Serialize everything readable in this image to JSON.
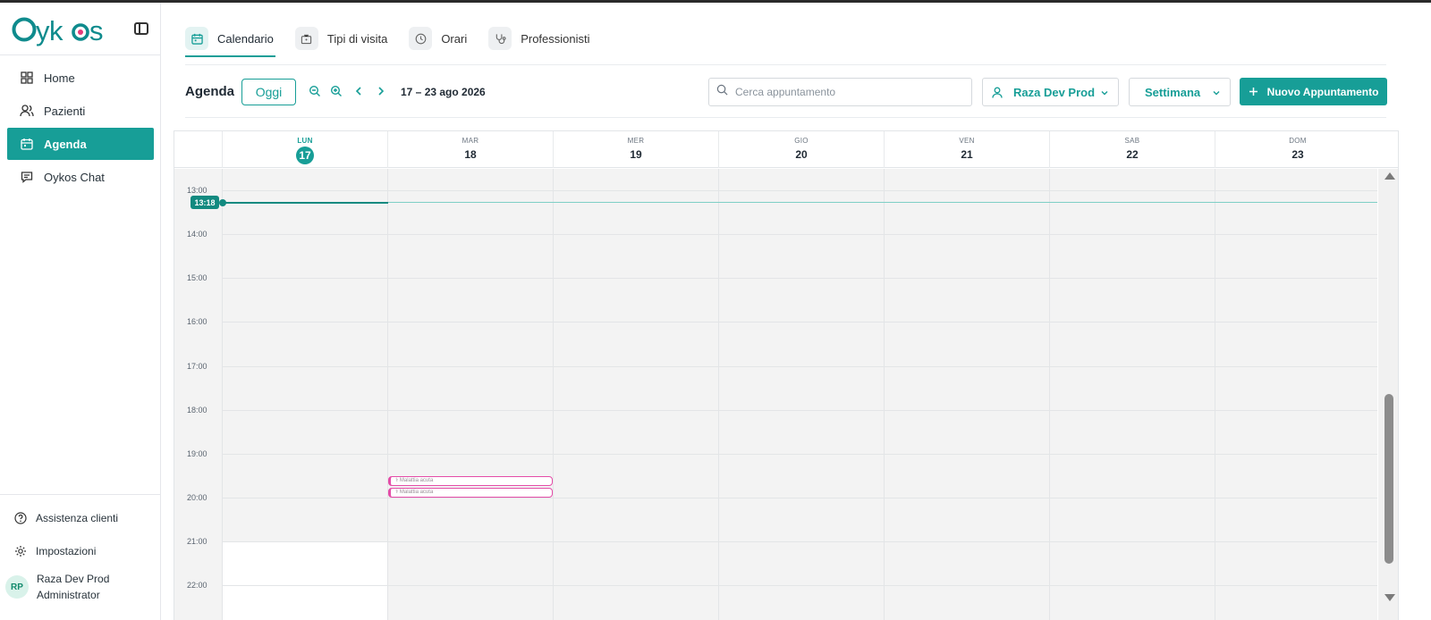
{
  "app": {
    "logo_text": "Oykos",
    "accent_color": "#179e97",
    "event_color": "#e44ca8"
  },
  "sidebar": {
    "items": [
      {
        "label": "Home",
        "icon": "grid-icon",
        "active": false
      },
      {
        "label": "Pazienti",
        "icon": "users-icon",
        "active": false
      },
      {
        "label": "Agenda",
        "icon": "calendar-icon",
        "active": true
      },
      {
        "label": "Oykos Chat",
        "icon": "chat-icon",
        "active": false
      }
    ],
    "support_label": "Assistenza clienti",
    "settings_label": "Impostazioni",
    "user": {
      "initials": "RP",
      "name": "Raza Dev Prod",
      "role": "Administrator"
    }
  },
  "tabs": [
    {
      "label": "Calendario",
      "icon": "calendar-icon",
      "active": true
    },
    {
      "label": "Tipi di visita",
      "icon": "briefcase-icon",
      "active": false
    },
    {
      "label": "Orari",
      "icon": "clock-icon",
      "active": false
    },
    {
      "label": "Professionisti",
      "icon": "stethoscope-icon",
      "active": false
    }
  ],
  "toolbar": {
    "title": "Agenda",
    "today_label": "Oggi",
    "date_range": "17 – 23 ago 2026",
    "search_placeholder": "Cerca appuntamento",
    "professional": "Raza Dev Prod",
    "view": "Settimana",
    "new_label": "Nuovo Appuntamento"
  },
  "calendar": {
    "days": [
      {
        "name": "LUN",
        "num": "17",
        "today": true
      },
      {
        "name": "MAR",
        "num": "18",
        "today": false
      },
      {
        "name": "MER",
        "num": "19",
        "today": false
      },
      {
        "name": "GIO",
        "num": "20",
        "today": false
      },
      {
        "name": "VEN",
        "num": "21",
        "today": false
      },
      {
        "name": "SAB",
        "num": "22",
        "today": false
      },
      {
        "name": "DOM",
        "num": "23",
        "today": false
      }
    ],
    "hours": [
      "13:00",
      "14:00",
      "15:00",
      "16:00",
      "17:00",
      "18:00",
      "19:00",
      "20:00",
      "21:00",
      "22:00"
    ],
    "now_label": "13:18",
    "events": [
      {
        "day": "MAR",
        "title": "Malattia acuta"
      },
      {
        "day": "MAR",
        "title": "Malattia acuta"
      }
    ]
  }
}
